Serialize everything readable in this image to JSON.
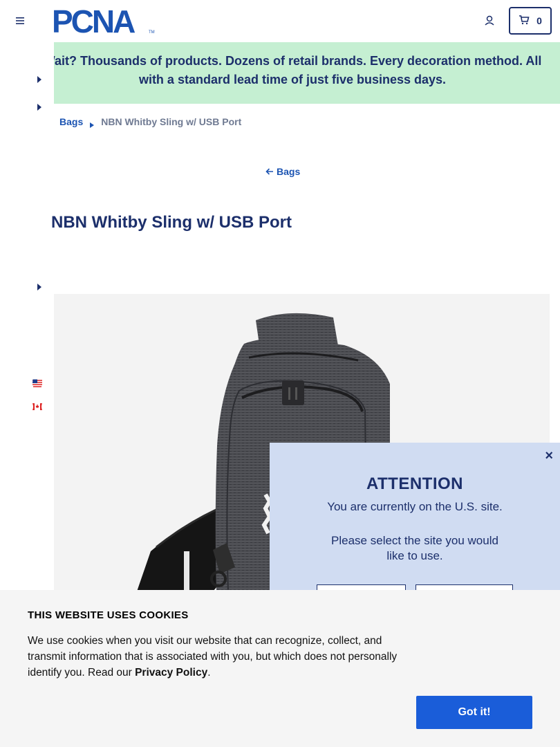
{
  "header": {
    "logo_text": "PCNA",
    "cart_count": "0"
  },
  "banner": {
    "text": "Wait? Thousands of products. Dozens of retail brands. Every decoration method. All with a standard lead time of just five business days."
  },
  "breadcrumb": {
    "parent": "Bags",
    "current": "NBN Whitby Sling w/ USB Port"
  },
  "back_link": "Bags",
  "product": {
    "title": "NBN Whitby Sling w/ USB Port"
  },
  "attention": {
    "title": "ATTENTION",
    "line1": "You are currently on the U.S. site.",
    "line2": "Please select the site you would",
    "line3": "like to use.",
    "close": "×"
  },
  "cookie": {
    "title": "THIS WEBSITE USES COOKIES",
    "text_before": "We use cookies when you visit our website that can recognize, collect, and transmit information that is associated with you, but which does not personally identify you. Read our ",
    "link": "Privacy Policy",
    "text_after": ".",
    "button": "Got it!"
  },
  "colors": {
    "navy": "#1c2f6b",
    "link_blue": "#1c54b2",
    "banner_green": "#c5efd2",
    "modal_blue": "#d0dcf2",
    "cookie_button": "#1a5dd9"
  }
}
